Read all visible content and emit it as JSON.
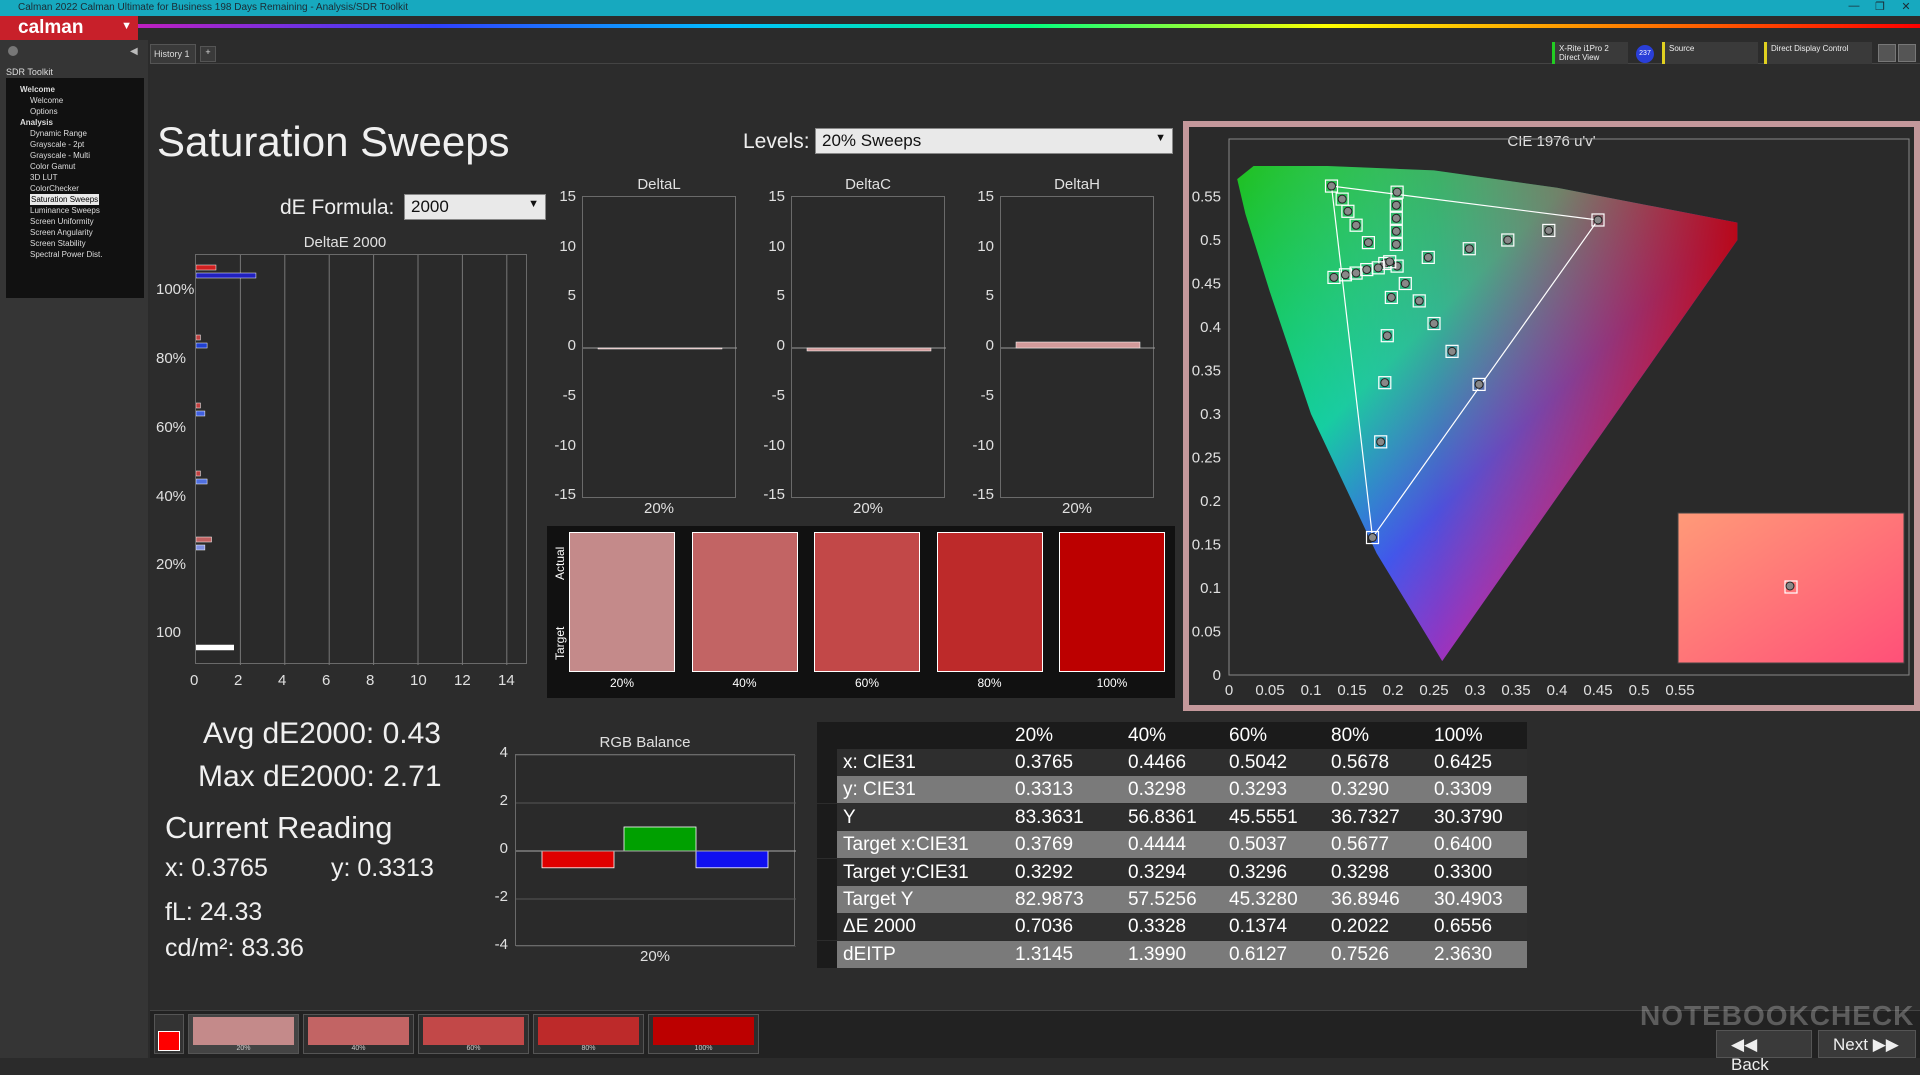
{
  "window": {
    "title": "Calman 2022 Calman Ultimate for Business 198 Days Remaining - Analysis/SDR Toolkit",
    "min": "—",
    "max": "❐",
    "close": "✕"
  },
  "app": {
    "logo": "calman"
  },
  "tabs": {
    "history": "History 1",
    "add": "+"
  },
  "devices": [
    {
      "line1": "X-Rite i1Pro 2",
      "line2": "Direct View",
      "badge": "237"
    },
    {
      "line1": "Source",
      "line2": ""
    },
    {
      "line1": "Direct Display Control",
      "line2": ""
    }
  ],
  "sidebar": {
    "title": "SDR Toolkit",
    "items": [
      {
        "label": "Welcome",
        "level": 0,
        "bold": true
      },
      {
        "label": "Welcome",
        "level": 1
      },
      {
        "label": "Options",
        "level": 1
      },
      {
        "label": "Analysis",
        "level": 0,
        "bold": true
      },
      {
        "label": "Dynamic Range",
        "level": 1
      },
      {
        "label": "Grayscale - 2pt",
        "level": 1
      },
      {
        "label": "Grayscale - Multi",
        "level": 1
      },
      {
        "label": "Color Gamut",
        "level": 1
      },
      {
        "label": "3D LUT",
        "level": 1
      },
      {
        "label": "ColorChecker",
        "level": 1
      },
      {
        "label": "Saturation Sweeps",
        "level": 1,
        "selected": true
      },
      {
        "label": "Luminance Sweeps",
        "level": 1
      },
      {
        "label": "Screen Uniformity",
        "level": 1
      },
      {
        "label": "Screen Angularity",
        "level": 1
      },
      {
        "label": "Screen Stability",
        "level": 1
      },
      {
        "label": "Spectral Power Dist.",
        "level": 1
      }
    ]
  },
  "page": {
    "title": "Saturation Sweeps",
    "levels_label": "Levels:",
    "levels_value": "20% Sweeps",
    "de_formula_label": "dE Formula:",
    "de_formula_value": "2000"
  },
  "deltae_chart": {
    "title": "DeltaE 2000",
    "y_labels": [
      "100%",
      "80%",
      "60%",
      "40%",
      "20%",
      "100"
    ],
    "x_ticks": [
      "0",
      "2",
      "4",
      "6",
      "8",
      "10",
      "12",
      "14"
    ]
  },
  "small_charts": [
    {
      "title": "DeltaL",
      "xlabel": "20%",
      "value": 0.0
    },
    {
      "title": "DeltaC",
      "xlabel": "20%",
      "value": -0.3
    },
    {
      "title": "DeltaH",
      "xlabel": "20%",
      "value": 0.6
    }
  ],
  "small_ticks": [
    "15",
    "10",
    "5",
    "0",
    "-5",
    "-10",
    "-15"
  ],
  "swatches": {
    "actual_label": "Actual",
    "target_label": "Target",
    "items": [
      {
        "label": "20%",
        "color": "#c48a8a"
      },
      {
        "label": "40%",
        "color": "#c26464"
      },
      {
        "label": "60%",
        "color": "#c24848"
      },
      {
        "label": "80%",
        "color": "#bd2a2a"
      },
      {
        "label": "100%",
        "color": "#bc0000"
      }
    ]
  },
  "cie": {
    "title": "CIE 1976 u'v'",
    "y_ticks": [
      "0.55",
      "0.5",
      "0.45",
      "0.4",
      "0.35",
      "0.3",
      "0.25",
      "0.2",
      "0.15",
      "0.1",
      "0.05",
      "0"
    ],
    "x_ticks": [
      "0",
      "0.05",
      "0.1",
      "0.15",
      "0.2",
      "0.25",
      "0.3",
      "0.35",
      "0.4",
      "0.45",
      "0.5",
      "0.55"
    ]
  },
  "readings": {
    "avg": "Avg dE2000: 0.43",
    "max": "Max dE2000: 2.71",
    "current_title": "Current Reading",
    "x": "x: 0.3765",
    "y": "y: 0.3313",
    "fl": "fL: 24.33",
    "cdm2": "cd/m²: 83.36"
  },
  "rgb_balance": {
    "title": "RGB Balance",
    "y_ticks": [
      "4",
      "2",
      "0",
      "-2",
      "-4"
    ],
    "xlabel": "20%",
    "values": {
      "r": -0.7,
      "g": 1.0,
      "b": -0.7
    }
  },
  "table": {
    "headers": [
      "",
      "20%",
      "40%",
      "60%",
      "80%",
      "100%"
    ],
    "rows": [
      [
        "x: CIE31",
        "0.3765",
        "0.4466",
        "0.5042",
        "0.5678",
        "0.6425"
      ],
      [
        "y: CIE31",
        "0.3313",
        "0.3298",
        "0.3293",
        "0.3290",
        "0.3309"
      ],
      [
        "Y",
        "83.3631",
        "56.8361",
        "45.5551",
        "36.7327",
        "30.3790"
      ],
      [
        "Target x:CIE31",
        "0.3769",
        "0.4444",
        "0.5037",
        "0.5677",
        "0.6400"
      ],
      [
        "Target y:CIE31",
        "0.3292",
        "0.3294",
        "0.3296",
        "0.3298",
        "0.3300"
      ],
      [
        "Target Y",
        "82.9873",
        "57.5256",
        "45.3280",
        "36.8946",
        "30.4903"
      ],
      [
        "ΔE 2000",
        "0.7036",
        "0.3328",
        "0.1374",
        "0.2022",
        "0.6556"
      ],
      [
        "dEITP",
        "1.3145",
        "1.3990",
        "0.6127",
        "0.7526",
        "2.3630"
      ]
    ]
  },
  "bottom": {
    "thumbs": [
      {
        "label": "20%",
        "color": "#c48a8a"
      },
      {
        "label": "40%",
        "color": "#c26464"
      },
      {
        "label": "60%",
        "color": "#c24848"
      },
      {
        "label": "80%",
        "color": "#bd2a2a"
      },
      {
        "label": "100%",
        "color": "#bc0000"
      }
    ],
    "back": "Back",
    "next": "Next",
    "watermark": "NOTEBOOKCHECK"
  }
}
